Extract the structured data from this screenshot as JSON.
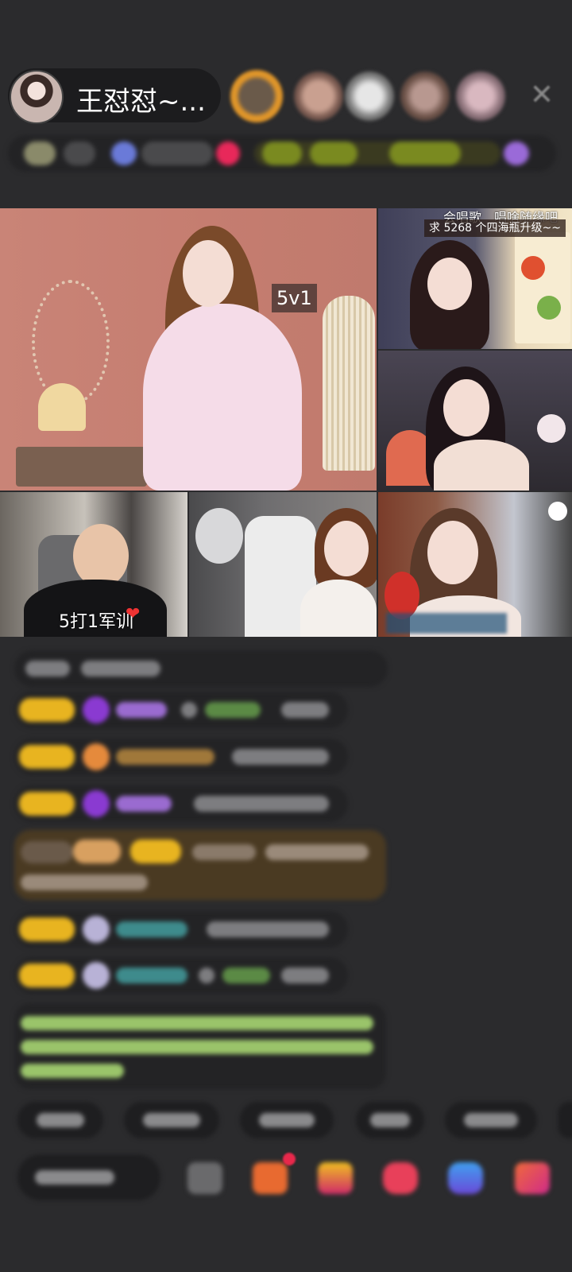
{
  "host": {
    "name": "王怼怼~..."
  },
  "stream": {
    "labels": {
      "pk_mode": "5v1",
      "host_caption": "5打1军训",
      "tile_tr1_caption_left": "会唱歌",
      "tile_tr1_caption_right": "唱啥随缘吧",
      "tile_tr1_goal": "求 5268 个四海瓶升级~~"
    }
  },
  "icons": {
    "close": "close-icon",
    "heart": "heart-icon"
  },
  "colors": {
    "background": "#2b2b2d",
    "pill": "#1c1c1e",
    "badge_gold": "#e8b420",
    "notification_red": "#e8284b"
  }
}
